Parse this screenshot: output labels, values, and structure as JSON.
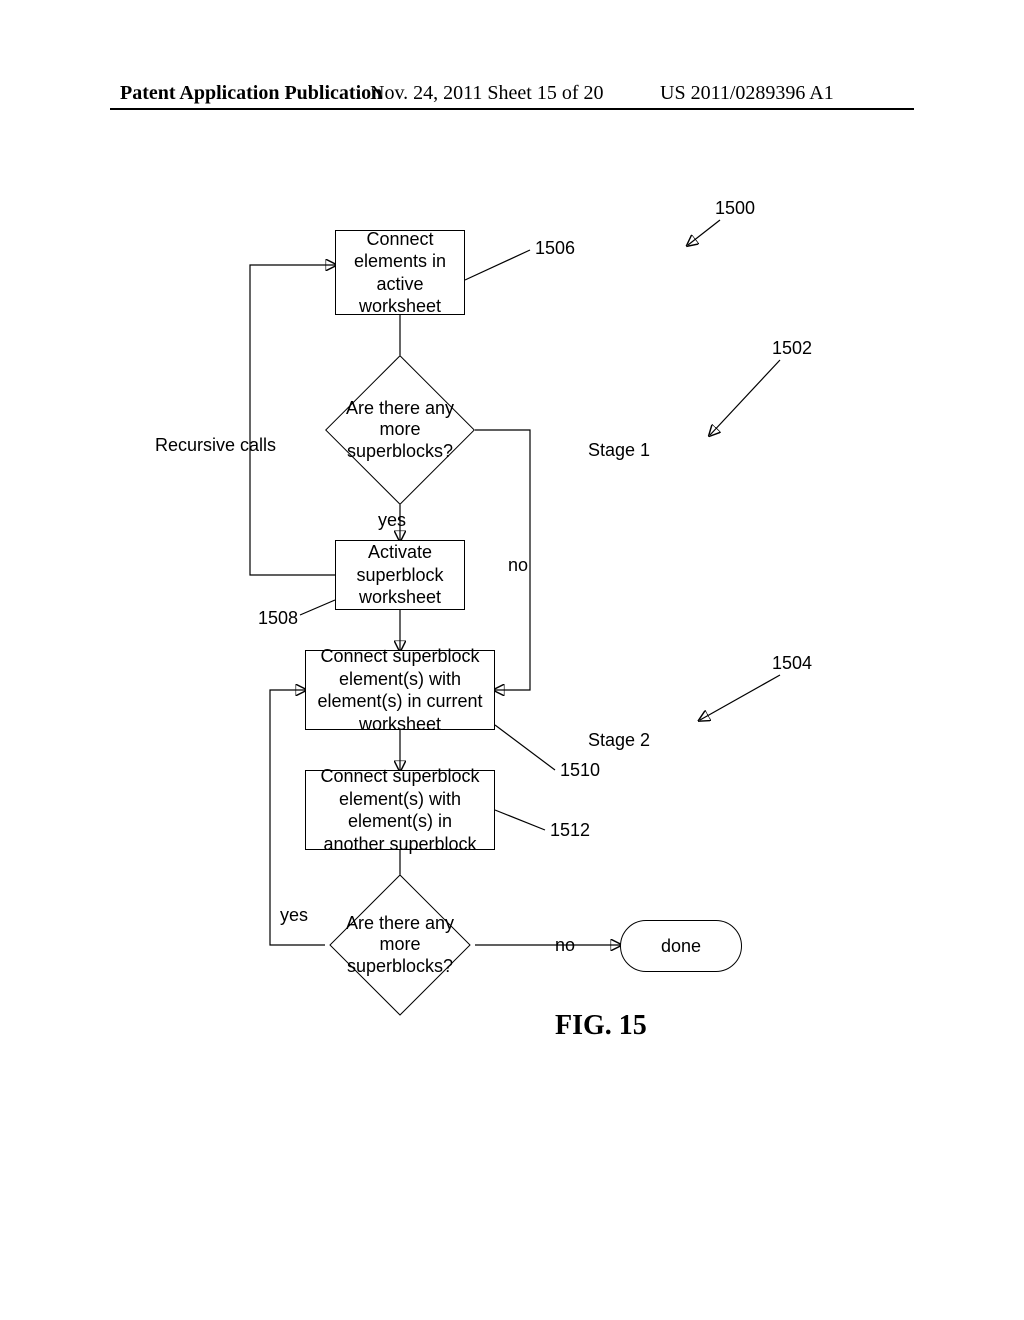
{
  "header": {
    "left": "Patent Application Publication",
    "mid": "Nov. 24, 2011  Sheet 15 of 20",
    "right": "US 2011/0289396 A1"
  },
  "flow": {
    "b1506": "Connect\nelements in\nactive worksheet",
    "d1": "Are there any more\nsuperblocks?",
    "b1508": "Activate\nsuperblock\nworksheet",
    "b1510": "Connect superblock\nelement(s) with element(s)\nin current worksheet",
    "b1512": "Connect superblock\nelement(s) with element(s)\nin another superblock",
    "d2": "Are there any more\nsuperblocks?",
    "done": "done",
    "yes1": "yes",
    "no1": "no",
    "yes2": "yes",
    "no2": "no"
  },
  "annot": {
    "recursive": "Recursive calls",
    "stage1": "Stage 1",
    "stage2": "Stage 2",
    "n1500": "1500",
    "n1502": "1502",
    "n1504": "1504",
    "n1506": "1506",
    "n1508": "1508",
    "n1510": "1510",
    "n1512": "1512"
  },
  "figure": "FIG. 15",
  "chart_data": {
    "type": "flowchart",
    "title": "FIG. 15",
    "nodes": [
      {
        "id": "1506",
        "type": "process",
        "text": "Connect elements in active worksheet"
      },
      {
        "id": "d1",
        "type": "decision",
        "text": "Are there any more superblocks?"
      },
      {
        "id": "1508",
        "type": "process",
        "text": "Activate superblock worksheet"
      },
      {
        "id": "1510",
        "type": "process",
        "text": "Connect superblock element(s) with element(s) in current worksheet"
      },
      {
        "id": "1512",
        "type": "process",
        "text": "Connect superblock element(s) with element(s) in another superblock"
      },
      {
        "id": "d2",
        "type": "decision",
        "text": "Are there any more superblocks?"
      },
      {
        "id": "done",
        "type": "terminator",
        "text": "done"
      }
    ],
    "edges": [
      {
        "from": "1506",
        "to": "d1"
      },
      {
        "from": "d1",
        "to": "1508",
        "label": "yes"
      },
      {
        "from": "1508",
        "to": "1506",
        "label": "Recursive calls"
      },
      {
        "from": "d1",
        "to": "1510",
        "label": "no"
      },
      {
        "from": "1508",
        "to": "1510"
      },
      {
        "from": "1510",
        "to": "1512"
      },
      {
        "from": "1512",
        "to": "d2"
      },
      {
        "from": "d2",
        "to": "1510",
        "label": "yes"
      },
      {
        "from": "d2",
        "to": "done",
        "label": "no"
      }
    ],
    "groups": [
      {
        "id": "1502",
        "label": "Stage 1",
        "contains": [
          "1506",
          "d1",
          "1508"
        ]
      },
      {
        "id": "1504",
        "label": "Stage 2",
        "contains": [
          "1510",
          "1512",
          "d2",
          "done"
        ]
      }
    ],
    "ref": "1500"
  }
}
